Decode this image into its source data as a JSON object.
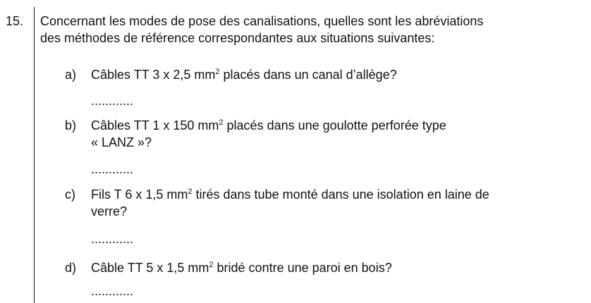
{
  "question": {
    "number": "15.",
    "intro_lines": [
      "Concernant les modes de pose des canalisations, quelles sont les abréviations",
      "des méthodes de référence correspondantes aux situations suivantes:"
    ]
  },
  "items": [
    {
      "letter": "a)",
      "pre": "Câbles TT 3 x 2,5 mm",
      "sup": "2",
      "post": " placés dans un canal d’allège?",
      "line2": "",
      "answer": "............"
    },
    {
      "letter": "b)",
      "pre": "Câbles TT 1 x 150 mm",
      "sup": "2",
      "post": " placés dans une goulotte perforée type",
      "line2": "« LANZ »?",
      "answer": "............"
    },
    {
      "letter": "c)",
      "pre": "Fils T 6 x 1,5 mm",
      "sup": "2",
      "post": " tirés dans tube monté dans une isolation en laine de",
      "line2": "verre?",
      "answer": "............"
    },
    {
      "letter": "d)",
      "pre": "Câble TT 5 x 1,5 mm",
      "sup": "2",
      "post": " bridé contre une paroi en bois?",
      "line2": "",
      "answer": "............"
    }
  ]
}
